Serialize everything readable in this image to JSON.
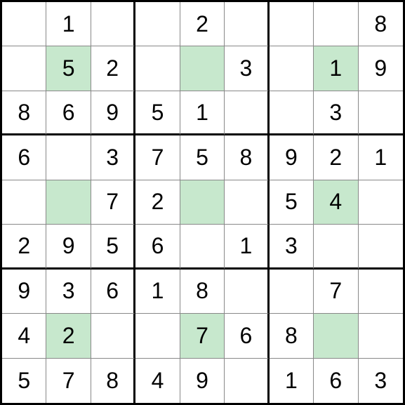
{
  "sudoku": {
    "grid": [
      [
        "",
        "1",
        "",
        "",
        "2",
        "",
        "",
        "",
        "8"
      ],
      [
        "",
        "5",
        "2",
        "",
        "",
        "3",
        "",
        "1",
        "9"
      ],
      [
        "8",
        "6",
        "9",
        "5",
        "1",
        "",
        "",
        "3",
        ""
      ],
      [
        "6",
        "",
        "3",
        "7",
        "5",
        "8",
        "9",
        "2",
        "1"
      ],
      [
        "",
        "",
        "7",
        "2",
        "",
        "",
        "5",
        "4",
        ""
      ],
      [
        "2",
        "9",
        "5",
        "6",
        "",
        "1",
        "3",
        "",
        ""
      ],
      [
        "9",
        "3",
        "6",
        "1",
        "8",
        "",
        "",
        "7",
        ""
      ],
      [
        "4",
        "2",
        "",
        "",
        "7",
        "6",
        "8",
        "",
        ""
      ],
      [
        "5",
        "7",
        "8",
        "4",
        "9",
        "",
        "1",
        "6",
        "3"
      ]
    ],
    "highlights": [
      [
        1,
        1
      ],
      [
        1,
        4
      ],
      [
        1,
        7
      ],
      [
        4,
        1
      ],
      [
        4,
        4
      ],
      [
        4,
        7
      ],
      [
        7,
        1
      ],
      [
        7,
        4
      ],
      [
        7,
        7
      ]
    ],
    "colors": {
      "highlight": "#c7e8cd",
      "cell_border_minor": "#888888",
      "cell_border_major": "#000000"
    }
  }
}
